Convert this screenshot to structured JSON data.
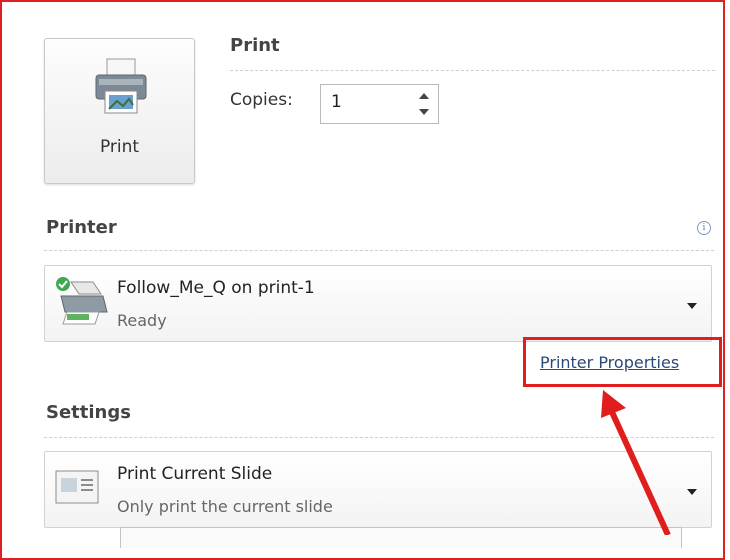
{
  "print_section": {
    "button_label": "Print",
    "title": "Print",
    "copies_label": "Copies:",
    "copies_value": "1"
  },
  "printer_section": {
    "title": "Printer",
    "selected_printer": {
      "name": "Follow_Me_Q on print-1",
      "status": "Ready"
    },
    "properties_link": "Printer Properties"
  },
  "settings_section": {
    "title": "Settings",
    "selected_setting": {
      "name": "Print Current Slide",
      "description": "Only print the current slide"
    }
  },
  "annotation_color": "#e01e1e",
  "icons": [
    "printer-icon",
    "info-icon",
    "printer-status-icon",
    "slide-icon",
    "dropdown-arrow-icon",
    "spinner-up-icon",
    "spinner-down-icon"
  ]
}
